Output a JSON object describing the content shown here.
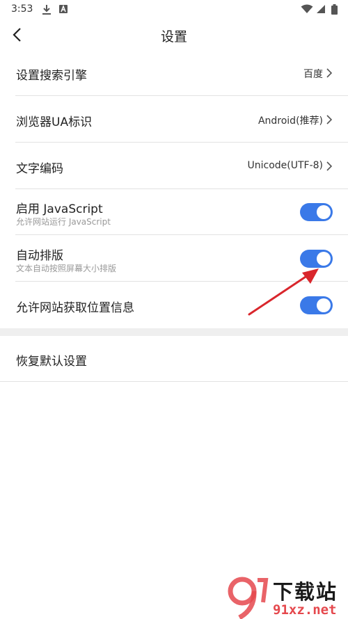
{
  "status_bar": {
    "time": "3:53"
  },
  "header": {
    "title": "设置"
  },
  "settings": {
    "search_engine": {
      "label": "设置搜索引擎",
      "value": "百度"
    },
    "ua": {
      "label": "浏览器UA标识",
      "value": "Android(推荐)"
    },
    "encoding": {
      "label": "文字编码",
      "value": "Unicode(UTF-8)"
    },
    "javascript": {
      "label": "启用 JavaScript",
      "sub": "允许网站运行 JavaScript",
      "enabled": true
    },
    "auto_layout": {
      "label": "自动排版",
      "sub": "文本自动按照屏幕大小排版",
      "enabled": true
    },
    "location": {
      "label": "允许网站获取位置信息",
      "enabled": true
    }
  },
  "reset": {
    "label": "恢复默认设置"
  },
  "watermark": {
    "brand": "下载站",
    "url": "91xz.net"
  },
  "colors": {
    "accent": "#3a79e8",
    "arrow": "#d9262c",
    "divider": "#e2e2e2",
    "section_gap": "#efefef"
  }
}
